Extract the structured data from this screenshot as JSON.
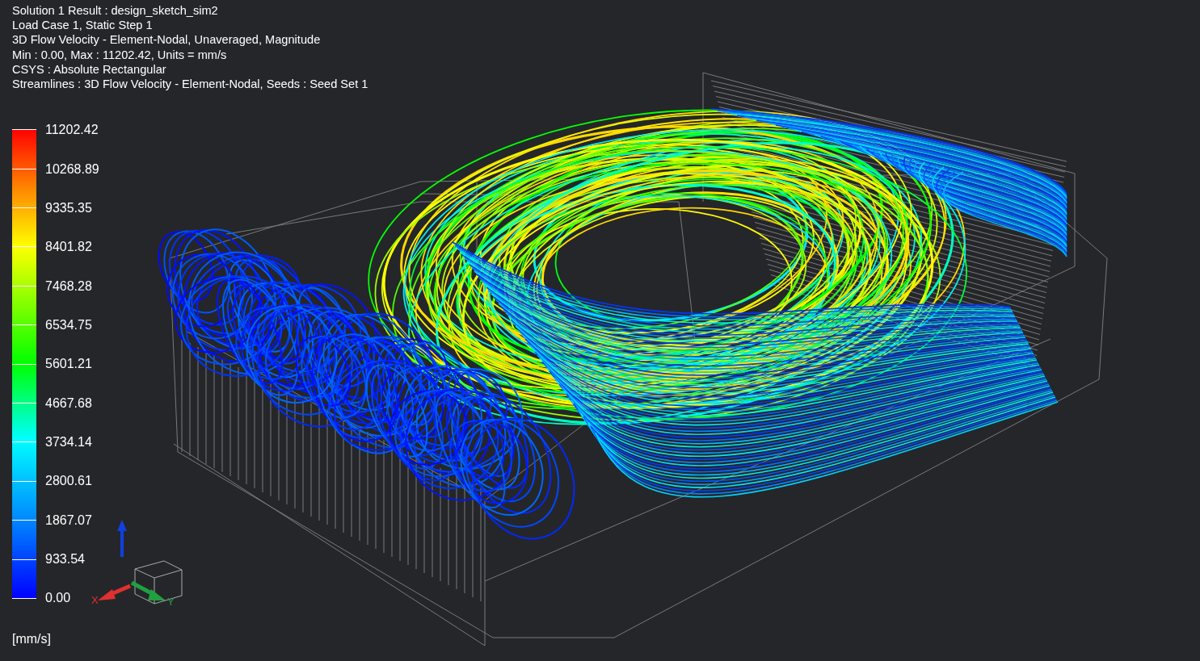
{
  "header": {
    "lines": [
      "Solution 1 Result : design_sketch_sim2",
      "Load Case 1, Static Step 1",
      "3D Flow Velocity - Element-Nodal, Unaveraged, Magnitude",
      "Min : 0.00, Max : 11202.42, Units = mm/s",
      "CSYS : Absolute Rectangular",
      "Streamlines : 3D Flow Velocity - Element-Nodal, Seeds : Seed Set 1"
    ]
  },
  "legend": {
    "labels": [
      "11202.42",
      "10268.89",
      "9335.35",
      "8401.82",
      "7468.28",
      "6534.75",
      "5601.21",
      "4667.68",
      "3734.14",
      "2800.61",
      "1867.07",
      "933.54",
      "0.00"
    ],
    "units": "[mm/s]"
  },
  "triad": {
    "axes": [
      {
        "kind": "x",
        "label": "X"
      },
      {
        "kind": "y",
        "label": "Y"
      }
    ]
  }
}
